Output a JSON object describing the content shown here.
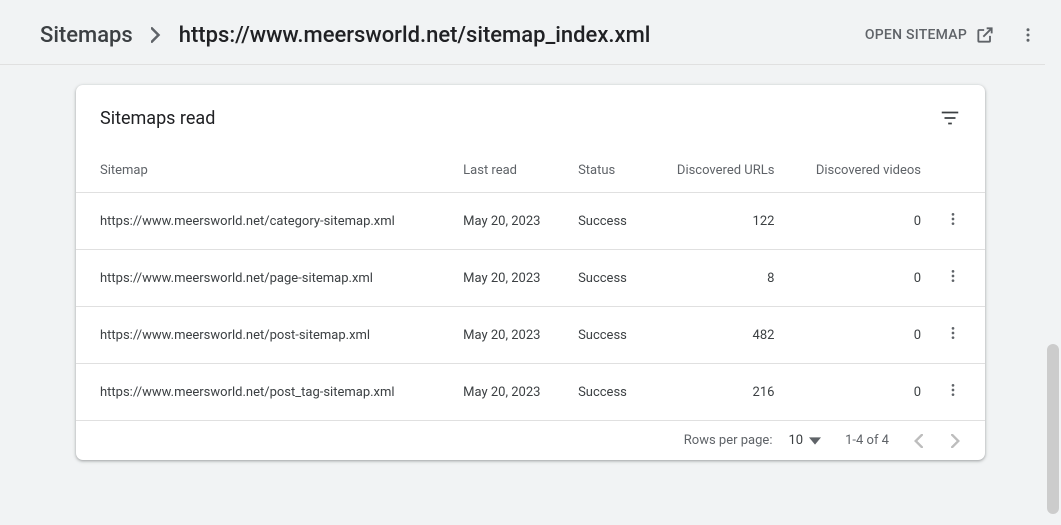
{
  "header": {
    "breadcrumb_root": "Sitemaps",
    "breadcrumb_current": "https://www.meersworld.net/sitemap_index.xml",
    "open_sitemap_label": "OPEN SITEMAP"
  },
  "card": {
    "title": "Sitemaps read",
    "columns": {
      "sitemap": "Sitemap",
      "last_read": "Last read",
      "status": "Status",
      "discovered_urls": "Discovered URLs",
      "discovered_videos": "Discovered videos"
    },
    "rows": [
      {
        "sitemap": "https://www.meersworld.net/category-sitemap.xml",
        "last_read": "May 20, 2023",
        "status": "Success",
        "discovered_urls": "122",
        "discovered_videos": "0"
      },
      {
        "sitemap": "https://www.meersworld.net/page-sitemap.xml",
        "last_read": "May 20, 2023",
        "status": "Success",
        "discovered_urls": "8",
        "discovered_videos": "0"
      },
      {
        "sitemap": "https://www.meersworld.net/post-sitemap.xml",
        "last_read": "May 20, 2023",
        "status": "Success",
        "discovered_urls": "482",
        "discovered_videos": "0"
      },
      {
        "sitemap": "https://www.meersworld.net/post_tag-sitemap.xml",
        "last_read": "May 20, 2023",
        "status": "Success",
        "discovered_urls": "216",
        "discovered_videos": "0"
      }
    ],
    "pagination": {
      "rows_per_page_label": "Rows per page:",
      "rows_per_page_value": "10",
      "range_label": "1-4 of 4"
    }
  }
}
